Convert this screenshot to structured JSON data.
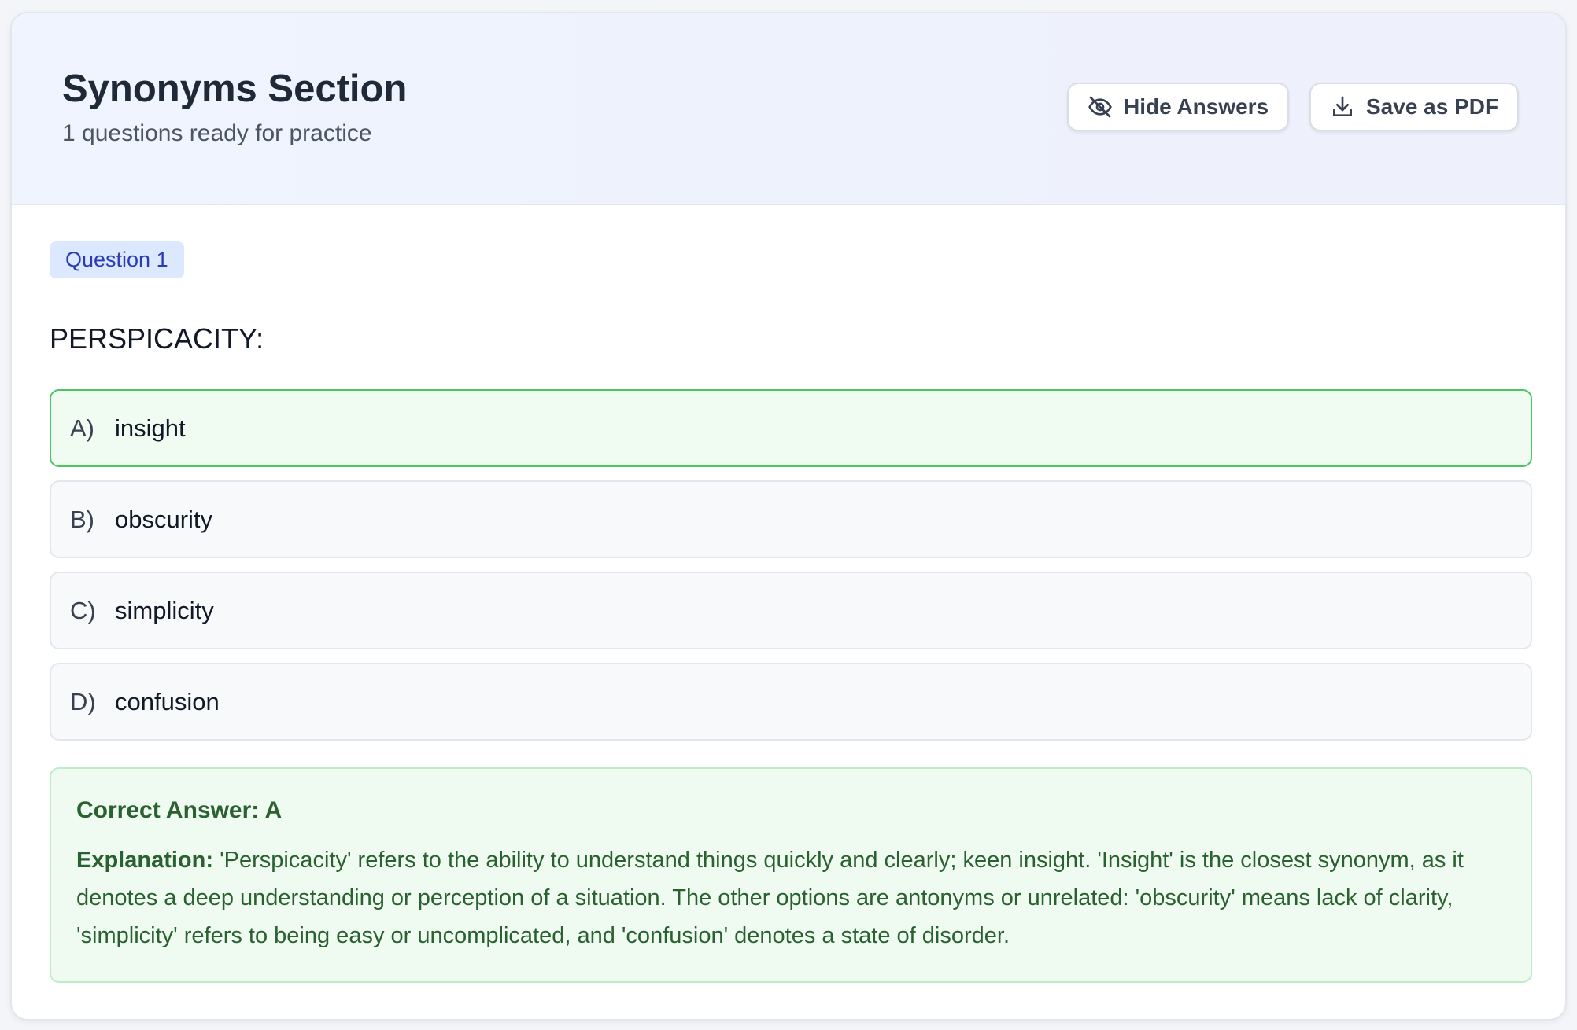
{
  "header": {
    "title": "Synonyms Section",
    "subtitle": "1 questions ready for practice",
    "hide_answers_label": "Hide Answers",
    "save_pdf_label": "Save as PDF",
    "hide_icon": "eye-off-icon",
    "save_icon": "download-icon"
  },
  "question": {
    "badge": "Question 1",
    "text": "PERSPICACITY:",
    "options": [
      {
        "letter": "A)",
        "text": "insight",
        "correct": true
      },
      {
        "letter": "B)",
        "text": "obscurity",
        "correct": false
      },
      {
        "letter": "C)",
        "text": "simplicity",
        "correct": false
      },
      {
        "letter": "D)",
        "text": "confusion",
        "correct": false
      }
    ],
    "correct_answer": "Correct Answer: A",
    "explanation_label": "Explanation:",
    "explanation": " 'Perspicacity' refers to the ability to understand things quickly and clearly; keen insight. 'Insight' is the closest synonym, as it denotes a deep understanding or perception of a situation. The other options are antonyms or unrelated: 'obscurity' means lack of clarity, 'simplicity' refers to being easy or uncomplicated, and 'confusion' denotes a state of disorder."
  },
  "colors": {
    "correct_border": "#4cc464",
    "correct_bg": "#f0fbf2",
    "badge_bg": "#dbe8fd",
    "badge_text": "#2b3bb8",
    "explanation_text": "#2a6130"
  }
}
